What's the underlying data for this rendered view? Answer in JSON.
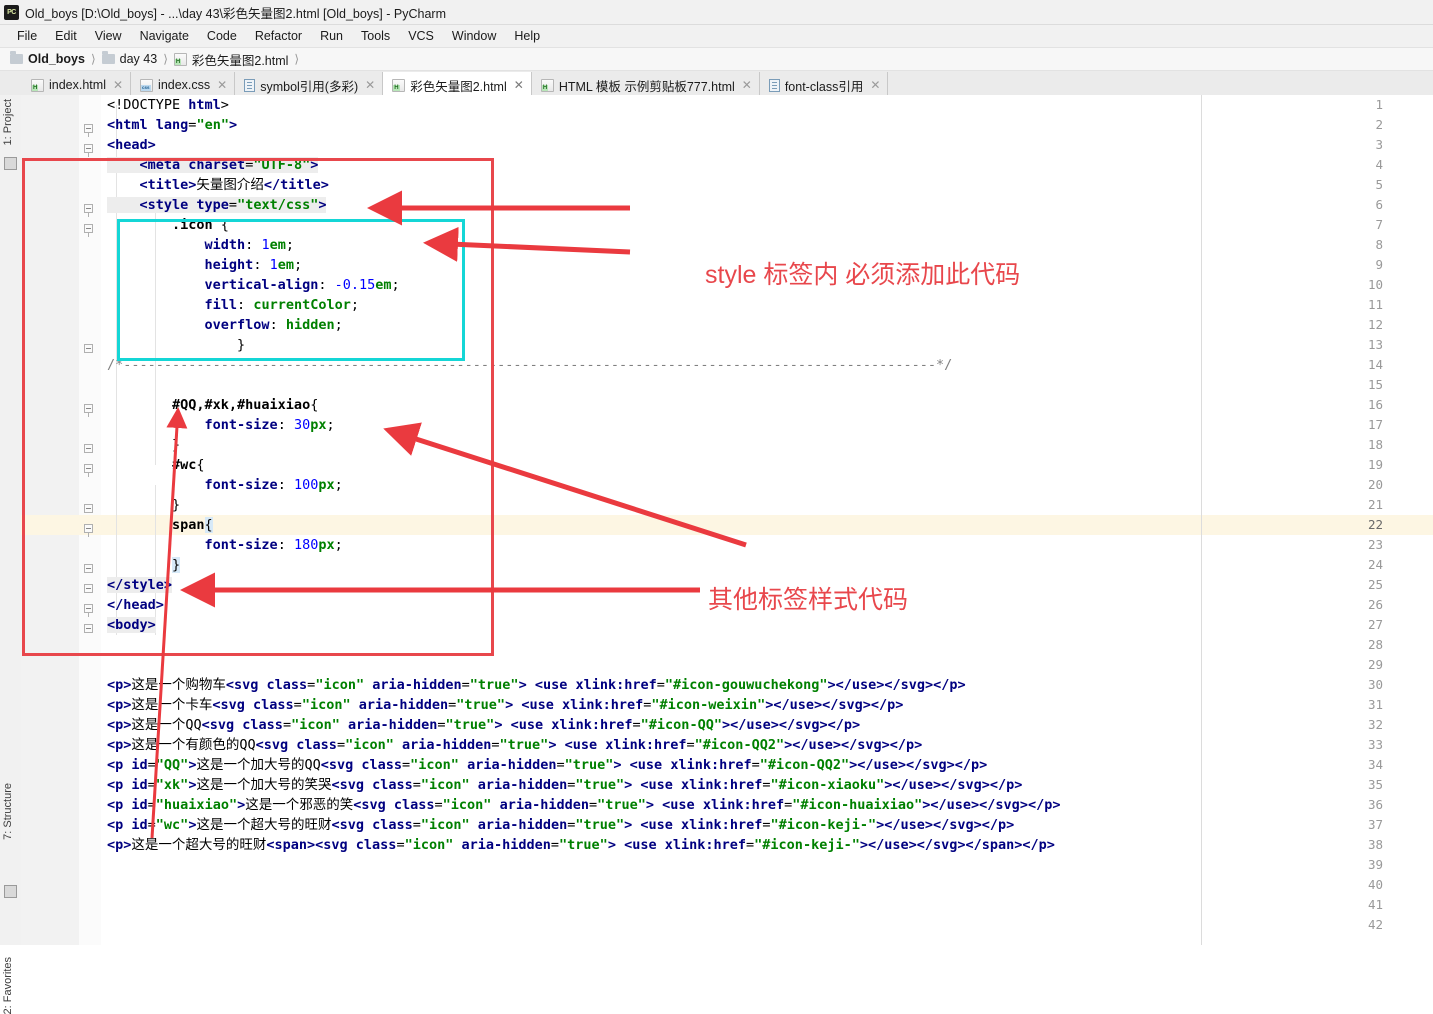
{
  "window": {
    "title": "Old_boys [D:\\Old_boys] - ...\\day 43\\彩色矢量图2.html [Old_boys] - PyCharm",
    "app_icon": "pycharm-icon"
  },
  "menu": [
    {
      "label": "File"
    },
    {
      "label": "Edit"
    },
    {
      "label": "View"
    },
    {
      "label": "Navigate"
    },
    {
      "label": "Code"
    },
    {
      "label": "Refactor"
    },
    {
      "label": "Run"
    },
    {
      "label": "Tools"
    },
    {
      "label": "VCS"
    },
    {
      "label": "Window"
    },
    {
      "label": "Help"
    }
  ],
  "breadcrumb": [
    {
      "label": "Old_boys",
      "icon": "folder-icon"
    },
    {
      "label": "day 43",
      "icon": "folder-icon"
    },
    {
      "label": "彩色矢量图2.html",
      "icon": "html-file-icon"
    }
  ],
  "tabs": [
    {
      "label": "index.html",
      "icon": "html-file-icon",
      "active": false
    },
    {
      "label": "index.css",
      "icon": "css-file-icon",
      "active": false
    },
    {
      "label": "symbol引用(多彩)",
      "icon": "text-file-icon",
      "active": false
    },
    {
      "label": "彩色矢量图2.html",
      "icon": "html-file-icon",
      "active": true
    },
    {
      "label": "HTML 模板 示例剪贴板777.html",
      "icon": "html-file-icon",
      "active": false
    },
    {
      "label": "font-class引用",
      "icon": "text-file-icon",
      "active": false
    }
  ],
  "tool_strip": {
    "left": [
      {
        "label": "1: Project"
      },
      {
        "label": "7: Structure"
      },
      {
        "label": "2: Favorites"
      }
    ]
  },
  "editor": {
    "line_numbers": [
      1,
      2,
      3,
      4,
      5,
      6,
      7,
      8,
      9,
      10,
      11,
      12,
      13,
      14,
      15,
      16,
      17,
      18,
      19,
      20,
      21,
      22,
      23,
      24,
      25,
      26,
      27,
      28,
      29,
      30,
      31,
      32,
      33,
      34,
      35,
      36,
      37,
      38,
      39,
      40,
      41,
      42
    ],
    "current_line": 22,
    "lines": {
      "1": "<!DOCTYPE html>",
      "2": "<html lang=\"en\">",
      "3": "<head>",
      "4": "    <meta charset=\"UTF-8\">",
      "5": "    <title>矢量图介绍</title>",
      "6": "    <style type=\"text/css\">",
      "7": "        .icon {",
      "8": "            width: 1em;",
      "9": "            height: 1em;",
      "10": "            vertical-align: -0.15em;",
      "11": "            fill: currentColor;",
      "12": "            overflow: hidden;",
      "13": "            }",
      "14": "/*------------------------------------------------------------------------------------*/",
      "15": "",
      "16": "        #QQ,#xk,#huaixiao{",
      "17": "            font-size: 30px;",
      "18": "        }",
      "19": "        #wc{",
      "20": "            font-size: 100px;",
      "21": "        }",
      "22": "        span{",
      "23": "            font-size: 180px;",
      "24": "        }",
      "25": "</style>",
      "26": "</head>",
      "27": "<body>",
      "28": "",
      "29": "",
      "30": "<p>这是一个购物车<svg class=\"icon\" aria-hidden=\"true\"> <use xlink:href=\"#icon-gouwuchekong\"></use></svg></p>",
      "31": "<p>这是一个卡车<svg class=\"icon\" aria-hidden=\"true\"> <use xlink:href=\"#icon-weixin\"></use></svg></p>",
      "32": "<p>这是一个QQ<svg class=\"icon\" aria-hidden=\"true\"> <use xlink:href=\"#icon-QQ\"></use></svg></p>",
      "33": "<p>这是一个有颜色的QQ<svg class=\"icon\" aria-hidden=\"true\"> <use xlink:href=\"#icon-QQ2\"></use></svg></p>",
      "34": "<p id=\"QQ\">这是一个加大号的QQ<svg class=\"icon\" aria-hidden=\"true\"> <use xlink:href=\"#icon-QQ2\"></use></svg></p>",
      "35": "<p id=\"xk\">这是一个加大号的笑哭<svg class=\"icon\" aria-hidden=\"true\"> <use xlink:href=\"#icon-xiaoku\"></use></svg></p>",
      "36": "<p id=\"huaixiao\">这是一个邪恶的笑<svg class=\"icon\" aria-hidden=\"true\"> <use xlink:href=\"#icon-huaixiao\"></use></svg></p>",
      "37": "<p id=\"wc\">这是一个超大号的旺财<svg class=\"icon\" aria-hidden=\"true\"> <use xlink:href=\"#icon-keji-\"></use></svg></p>",
      "38": "<p>这是一个超大号的旺财<span><svg class=\"icon\" aria-hidden=\"true\"> <use xlink:href=\"#icon-keji-\"></use></svg></span></p>",
      "39": "",
      "40": "",
      "41": "",
      "42": ""
    }
  },
  "annotations": [
    {
      "id": "anno-style-tag",
      "text": "style 标签内 必须添加此代码",
      "color": "#e8474c"
    },
    {
      "id": "anno-other-style",
      "text": "其他标签样式代码",
      "color": "#e8474c"
    }
  ],
  "colors": {
    "red_highlight": "#e8474c",
    "teal_highlight": "#14d6d6",
    "current_line_bg": "#fdf6e3",
    "selection_bg": "#d6e9f8"
  }
}
